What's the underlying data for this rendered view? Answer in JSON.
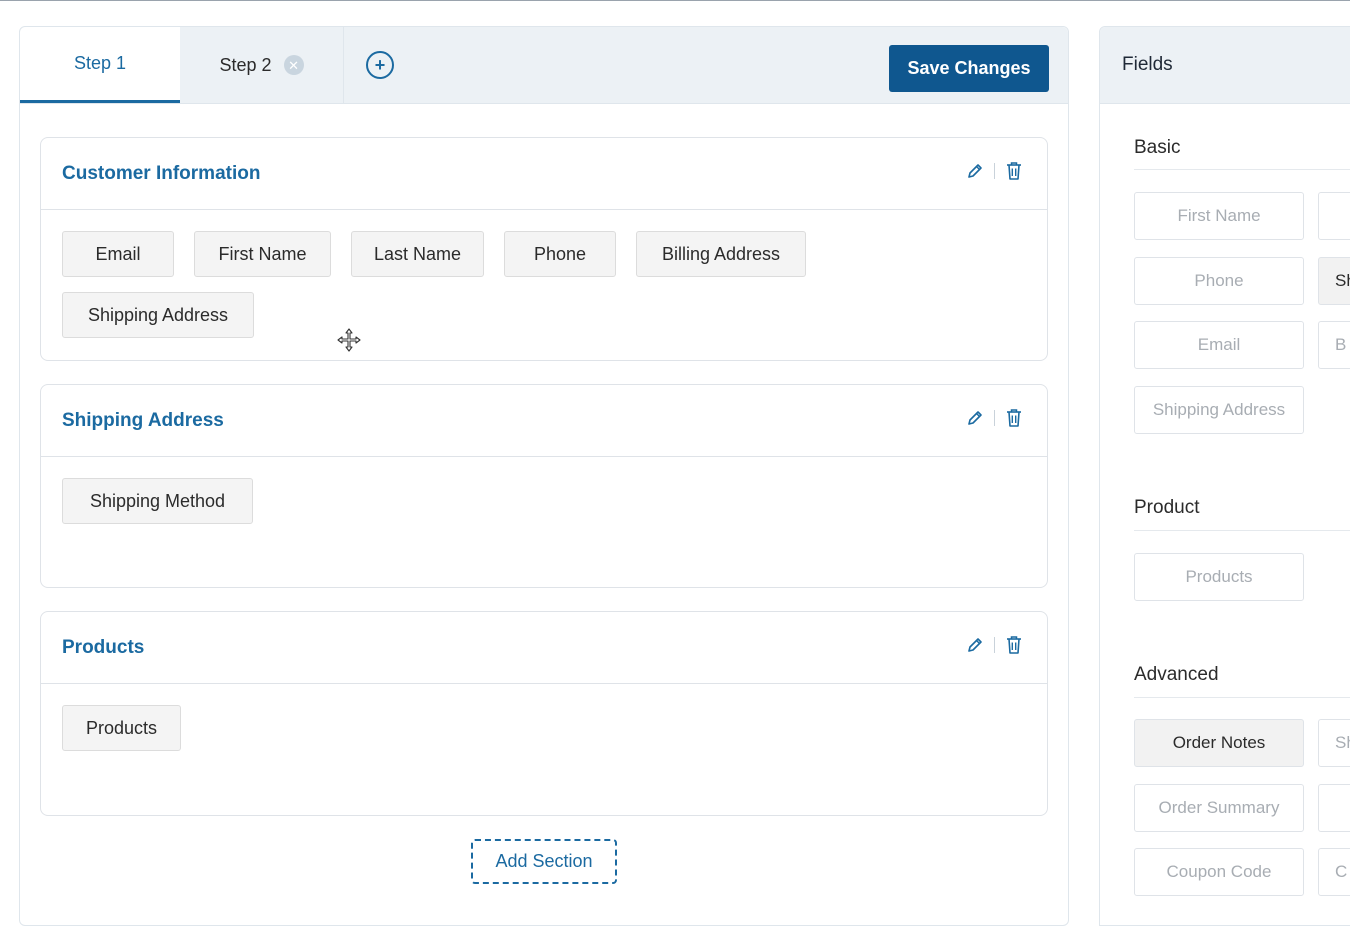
{
  "tabs": {
    "step1": "Step 1",
    "step2": "Step 2",
    "close_glyph": "✕",
    "add_glyph": "+"
  },
  "toolbar": {
    "save_label": "Save Changes"
  },
  "sections": [
    {
      "title": "Customer Information",
      "fields": [
        "Email",
        "First Name",
        "Last Name",
        "Phone",
        "Billing Address",
        "Shipping Address"
      ]
    },
    {
      "title": "Shipping Address",
      "fields": [
        "Shipping Method"
      ]
    },
    {
      "title": "Products",
      "fields": [
        "Products"
      ]
    }
  ],
  "add_section_label": "Add Section",
  "fields_panel": {
    "title": "Fields",
    "groups": {
      "basic": {
        "title": "Basic",
        "items": [
          "First Name",
          "Phone",
          "Email",
          "Shipping Address"
        ],
        "edge_items": [
          "",
          "Sh",
          "B"
        ]
      },
      "product": {
        "title": "Product",
        "items": [
          "Products"
        ]
      },
      "advanced": {
        "title": "Advanced",
        "items": [
          "Order Notes",
          "Order Summary",
          "Coupon Code"
        ],
        "edge_items": [
          "Sh",
          "",
          "C"
        ]
      }
    }
  },
  "icons": {
    "edit": "pencil-icon",
    "delete": "trash-icon",
    "move": "move-cursor-icon"
  },
  "colors": {
    "accent": "#1b6aa1",
    "save_button": "#0f578f",
    "tabbar_bg": "#ecf1f5",
    "chip_bg": "#f4f4f4"
  }
}
